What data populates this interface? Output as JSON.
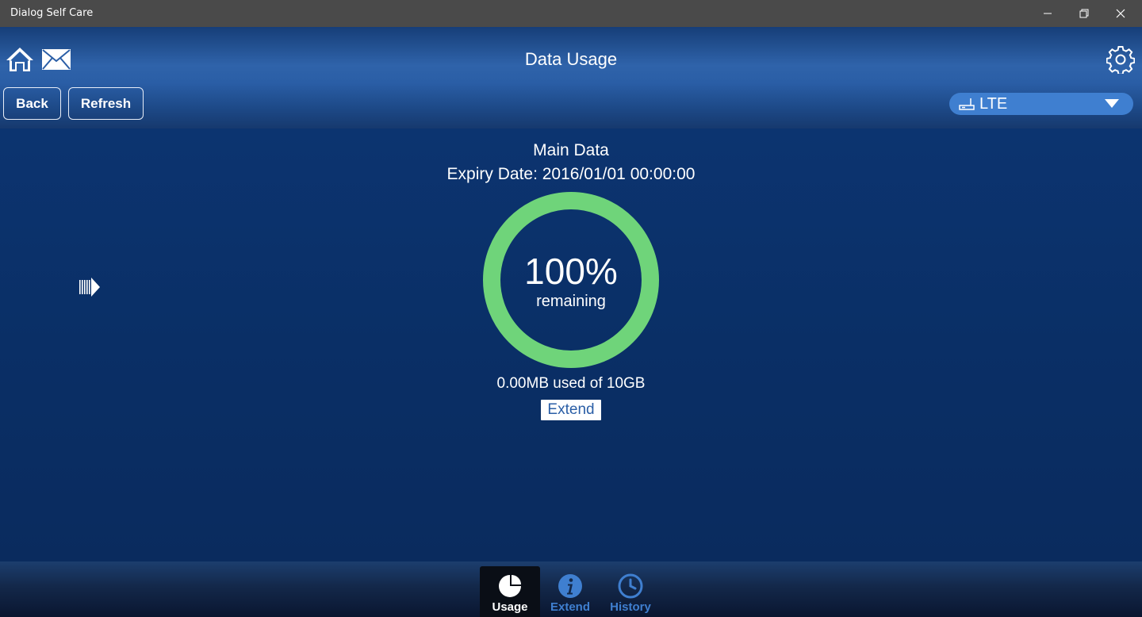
{
  "window": {
    "title": "Dialog Self Care"
  },
  "header": {
    "title": "Data Usage",
    "back_label": "Back",
    "refresh_label": "Refresh",
    "network": {
      "selected": "LTE"
    }
  },
  "usage": {
    "plan_name": "Main Data",
    "expiry": "Expiry Date: 2016/01/01 00:00:00",
    "percent_text": "100%",
    "percent_remaining": 100,
    "remaining_label": "remaining",
    "used_text": "0.00MB used of 10GB",
    "extend_label": "Extend"
  },
  "tabs": [
    {
      "label": "Usage",
      "icon": "pie-chart-icon",
      "active": true
    },
    {
      "label": "Extend",
      "icon": "info-icon",
      "active": false
    },
    {
      "label": "History",
      "icon": "clock-icon",
      "active": false
    }
  ],
  "colors": {
    "ring": "#6fd47a",
    "accent_blue": "#3f7fd0",
    "tab_inactive": "#3f7fd0",
    "tab_active": "#ffffff"
  }
}
